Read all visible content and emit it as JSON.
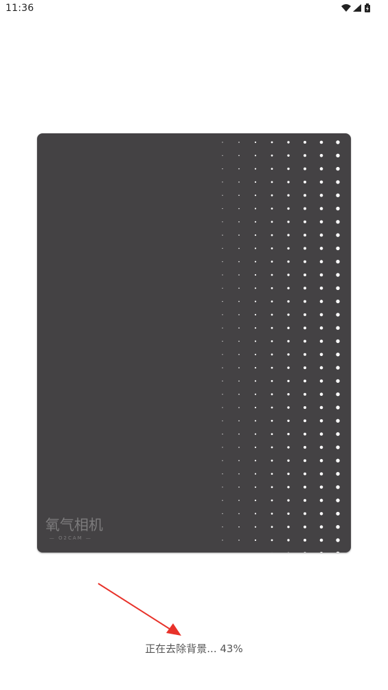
{
  "status_bar": {
    "time": "11:36",
    "icons": [
      "wifi-icon",
      "signal-icon",
      "battery-charging-icon"
    ]
  },
  "photo": {
    "background_color": "#444244",
    "watermark": {
      "chinese": "氧气相机",
      "english": "— O2CAM —"
    }
  },
  "progress": {
    "label": "正在去除背景...",
    "percent_text": "43%",
    "value": 0.43
  },
  "annotation": {
    "arrow_color": "#e8322a"
  }
}
